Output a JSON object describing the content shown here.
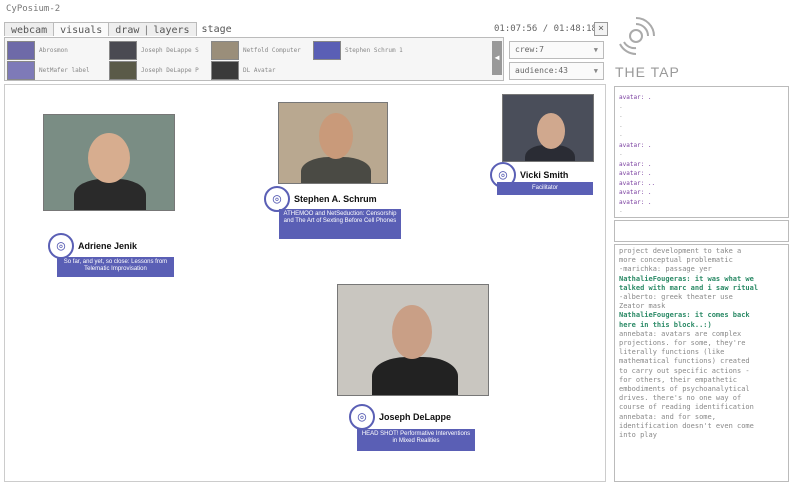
{
  "app": {
    "title": "CyPosium-2",
    "timer": "01:07:56 / 01:48:18",
    "close": "×"
  },
  "tabs": {
    "webcam": "webcam",
    "visuals": "visuals",
    "draw": "draw",
    "layers": "layers",
    "stage": "stage",
    "sep": "|"
  },
  "strip": {
    "items": [
      {
        "label": "Abrosmon",
        "color": "#6e6aa8"
      },
      {
        "label": "NetMafer label",
        "color": "#7e7ab8"
      },
      {
        "label": "Joseph DeLappe S",
        "color": "#4a4a52"
      },
      {
        "label": "Joseph DeLappe P",
        "color": "#5a5a48"
      },
      {
        "label": "Netfold Computer",
        "color": "#9a8e7a"
      },
      {
        "label": "DL Avatar",
        "color": "#3a3a3a"
      },
      {
        "label": "Stephen Schrum 1",
        "color": "#5a5fb5"
      }
    ],
    "scroll_icon": "◀"
  },
  "selects": {
    "crew": "crew:7",
    "audience": "audience:43",
    "caret": "▼"
  },
  "participants": [
    {
      "name": "Adriene Jenik",
      "caption": "So far, and yet, so close: Lessons from Telematic Improvisation",
      "icon": "◎",
      "bg": "#7a8d84",
      "skin": "#d7ad8f",
      "shirt": "#2a2a2a"
    },
    {
      "name": "Stephen A. Schrum",
      "caption": "ATHEMOO and NetSeduction: Censorship and The Art of Sexting Before Cell Phones",
      "icon": "◎",
      "bg": "#b9a890",
      "skin": "#c99a7a",
      "shirt": "#4a4a44"
    },
    {
      "name": "Vicki Smith",
      "caption": "Facilitator",
      "icon": "◎",
      "bg": "#4a4e5a",
      "skin": "#d0a88e",
      "shirt": "#2a2c34"
    },
    {
      "name": "Joseph DeLappe",
      "caption": "HEAD SHOT! Performative Interventions in Mixed Realities",
      "icon": "◎",
      "bg": "#c9c6c0",
      "skin": "#c99f86",
      "shirt": "#222"
    }
  ],
  "sidebar": {
    "brand": "THE TAP",
    "roster": [
      "avatar: .",
      "-",
      "-",
      "-",
      "-",
      "avatar: .",
      "-",
      "avatar: .",
      "avatar: .",
      "avatar: ..",
      "avatar: .",
      "avatar: .",
      "-"
    ],
    "chat": [
      {
        "text": "project development to take a",
        "hl": false
      },
      {
        "text": "more conceptual problematic",
        "hl": false
      },
      {
        "text": "-marichka: passage yer",
        "hl": false
      },
      {
        "text": "NathalieFougeras: it was what we",
        "hl": true
      },
      {
        "text": "talked with marc and i saw ritual",
        "hl": true
      },
      {
        "text": "-alberto: greek theater use",
        "hl": false
      },
      {
        "text": "Zeator mask",
        "hl": false
      },
      {
        "text": "NathalieFougeras: it comes back",
        "hl": true
      },
      {
        "text": "here in this block..:)",
        "hl": true
      },
      {
        "text": "annebata: avatars are complex",
        "hl": false
      },
      {
        "text": "projections. for some, they're",
        "hl": false
      },
      {
        "text": "literally functions (like",
        "hl": false
      },
      {
        "text": "mathematical functions) created",
        "hl": false
      },
      {
        "text": "to carry out specific actions -",
        "hl": false
      },
      {
        "text": "for others, their empathetic",
        "hl": false
      },
      {
        "text": "embodiments of psychoanalytical",
        "hl": false
      },
      {
        "text": "drives. there's no one way of",
        "hl": false
      },
      {
        "text": "course of reading identification",
        "hl": false
      },
      {
        "text": "annebata: and for some,",
        "hl": false
      },
      {
        "text": "identification doesn't even come",
        "hl": false
      },
      {
        "text": "into play",
        "hl": false
      }
    ]
  }
}
